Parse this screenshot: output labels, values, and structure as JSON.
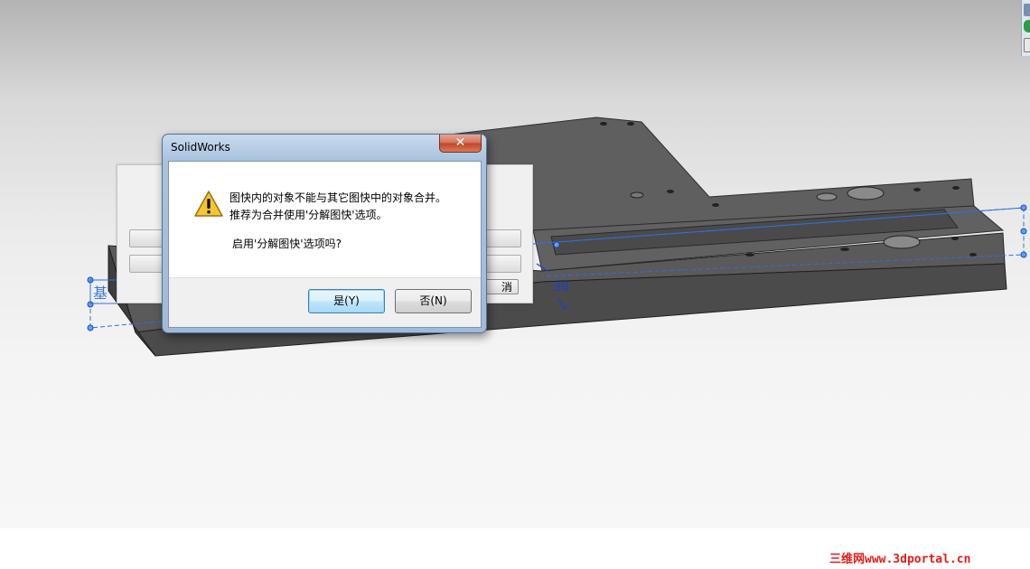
{
  "app": {
    "name": "SolidWorks"
  },
  "background_dialog": {
    "cancel_label_partial": "消"
  },
  "sketch": {
    "label_partial": "基",
    "dimension_text": "38"
  },
  "message_box": {
    "title": "SolidWorks",
    "close_glyph": "✕",
    "icon": "warning-icon",
    "lines": [
      "图快内的对象不能与其它图快中的对象合并。",
      "推荐为合并使用'分解图快'选项。",
      "启用'分解图快'选项吗?"
    ],
    "yes_label": "是(Y)",
    "no_label": "否(N)"
  },
  "watermark": {
    "text": "三维网www.3dportal.cn"
  },
  "colors": {
    "accent": "#3c7fb1",
    "sketch_blue": "#2f6fe0",
    "watermark": "#e31c19",
    "part": "#565656"
  }
}
